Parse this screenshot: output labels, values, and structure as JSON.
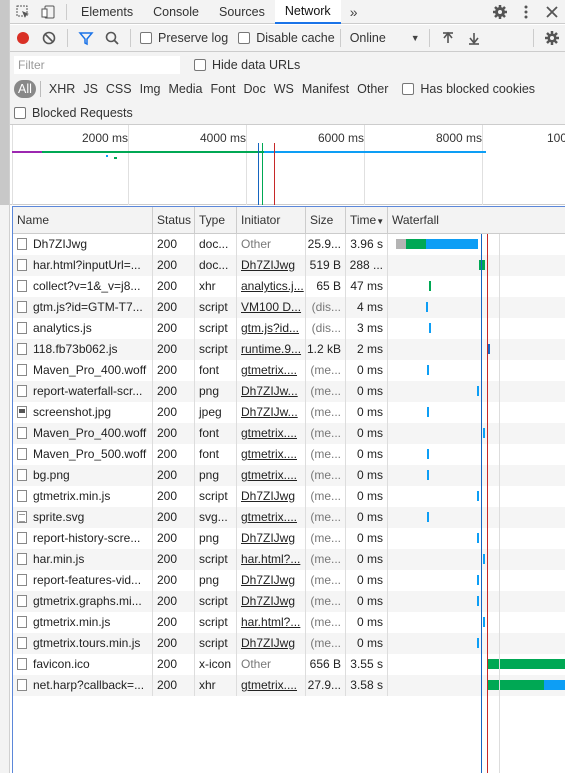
{
  "tabs": [
    "Elements",
    "Console",
    "Sources",
    "Network"
  ],
  "active_tab": "Network",
  "toolbar": {
    "preserve_log": "Preserve log",
    "disable_cache": "Disable cache",
    "throttle": "Online"
  },
  "filter": {
    "placeholder": "Filter",
    "hide_data_urls": "Hide data URLs"
  },
  "types": [
    "All",
    "XHR",
    "JS",
    "CSS",
    "Img",
    "Media",
    "Font",
    "Doc",
    "WS",
    "Manifest",
    "Other"
  ],
  "has_blocked_cookies": "Has blocked cookies",
  "blocked_requests": "Blocked Requests",
  "overview": {
    "ticks": [
      "2000 ms",
      "4000 ms",
      "6000 ms",
      "8000 ms",
      "100"
    ]
  },
  "columns": {
    "name": "Name",
    "status": "Status",
    "type": "Type",
    "initiator": "Initiator",
    "size": "Size",
    "time": "Time",
    "waterfall": "Waterfall"
  },
  "rows": [
    {
      "name": "Dh7ZIJwg",
      "status": "200",
      "type": "doc...",
      "initiator": "Other",
      "size": "25.9...",
      "time": "3.96 s",
      "icon": "doc"
    },
    {
      "name": "har.html?inputUrl=...",
      "status": "200",
      "type": "doc...",
      "initiator": "Dh7ZIJwg",
      "size": "519 B",
      "time": "288 ...",
      "icon": "doc"
    },
    {
      "name": "collect?v=1&_v=j8...",
      "status": "200",
      "type": "xhr",
      "initiator": "analytics.j...",
      "size": "65 B",
      "time": "47 ms",
      "icon": "doc"
    },
    {
      "name": "gtm.js?id=GTM-T7...",
      "status": "200",
      "type": "script",
      "initiator": "VM100 D...",
      "size": "(dis...",
      "time": "4 ms",
      "icon": "doc"
    },
    {
      "name": "analytics.js",
      "status": "200",
      "type": "script",
      "initiator": "gtm.js?id...",
      "size": "(dis...",
      "time": "3 ms",
      "icon": "doc"
    },
    {
      "name": "118.fb73b062.js",
      "status": "200",
      "type": "script",
      "initiator": "runtime.9...",
      "size": "1.2 kB",
      "time": "2 ms",
      "icon": "doc"
    },
    {
      "name": "Maven_Pro_400.woff",
      "status": "200",
      "type": "font",
      "initiator": "gtmetrix....",
      "size": "(me...",
      "time": "0 ms",
      "icon": "doc"
    },
    {
      "name": "report-waterfall-scr...",
      "status": "200",
      "type": "png",
      "initiator": "Dh7ZIJw...",
      "size": "(me...",
      "time": "0 ms",
      "icon": "doc"
    },
    {
      "name": "screenshot.jpg",
      "status": "200",
      "type": "jpeg",
      "initiator": "Dh7ZIJw...",
      "size": "(me...",
      "time": "0 ms",
      "icon": "img"
    },
    {
      "name": "Maven_Pro_400.woff",
      "status": "200",
      "type": "font",
      "initiator": "gtmetrix....",
      "size": "(me...",
      "time": "0 ms",
      "icon": "doc"
    },
    {
      "name": "Maven_Pro_500.woff",
      "status": "200",
      "type": "font",
      "initiator": "gtmetrix....",
      "size": "(me...",
      "time": "0 ms",
      "icon": "doc"
    },
    {
      "name": "bg.png",
      "status": "200",
      "type": "png",
      "initiator": "gtmetrix....",
      "size": "(me...",
      "time": "0 ms",
      "icon": "doc"
    },
    {
      "name": "gtmetrix.min.js",
      "status": "200",
      "type": "script",
      "initiator": "Dh7ZIJwg",
      "size": "(me...",
      "time": "0 ms",
      "icon": "doc"
    },
    {
      "name": "sprite.svg",
      "status": "200",
      "type": "svg...",
      "initiator": "gtmetrix....",
      "size": "(me...",
      "time": "0 ms",
      "icon": "svg"
    },
    {
      "name": "report-history-scre...",
      "status": "200",
      "type": "png",
      "initiator": "Dh7ZIJwg",
      "size": "(me...",
      "time": "0 ms",
      "icon": "doc"
    },
    {
      "name": "har.min.js",
      "status": "200",
      "type": "script",
      "initiator": "har.html?...",
      "size": "(me...",
      "time": "0 ms",
      "icon": "doc"
    },
    {
      "name": "report-features-vid...",
      "status": "200",
      "type": "png",
      "initiator": "Dh7ZIJwg",
      "size": "(me...",
      "time": "0 ms",
      "icon": "doc"
    },
    {
      "name": "gtmetrix.graphs.mi...",
      "status": "200",
      "type": "script",
      "initiator": "Dh7ZIJwg",
      "size": "(me...",
      "time": "0 ms",
      "icon": "doc"
    },
    {
      "name": "gtmetrix.min.js",
      "status": "200",
      "type": "script",
      "initiator": "har.html?...",
      "size": "(me...",
      "time": "0 ms",
      "icon": "doc"
    },
    {
      "name": "gtmetrix.tours.min.js",
      "status": "200",
      "type": "script",
      "initiator": "Dh7ZIJwg",
      "size": "(me...",
      "time": "0 ms",
      "icon": "doc"
    },
    {
      "name": "favicon.ico",
      "status": "200",
      "type": "x-icon",
      "initiator": "Other",
      "size": "656 B",
      "time": "3.55 s",
      "icon": "doc"
    },
    {
      "name": "net.harp?callback=...",
      "status": "200",
      "type": "xhr",
      "initiator": "gtmetrix....",
      "size": "27.9...",
      "time": "3.58 s",
      "icon": "doc"
    }
  ],
  "colors": {
    "accent": "#1a73e8",
    "waiting": "#00a854",
    "download": "#0d9ef5",
    "queue": "#b4b4b4",
    "dom": "#1565c0",
    "load": "#c62828"
  }
}
